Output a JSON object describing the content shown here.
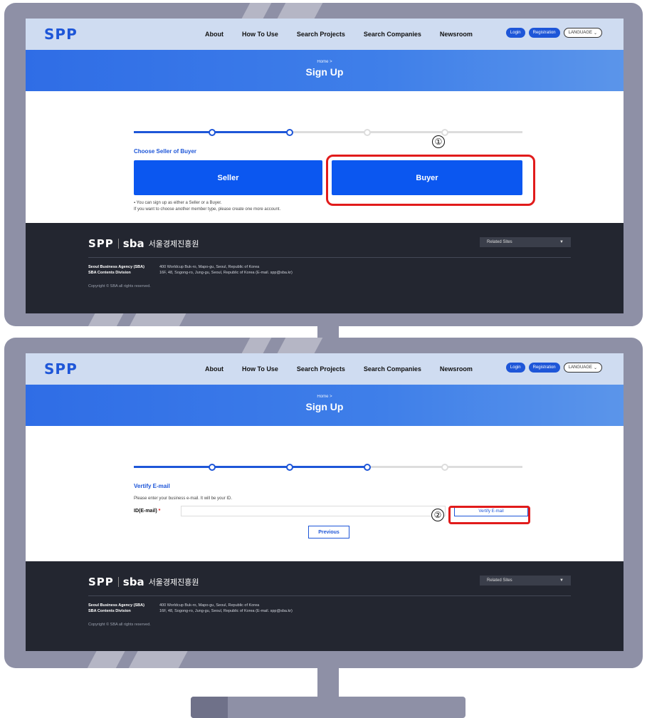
{
  "header": {
    "logo": "SPP",
    "nav": [
      "About",
      "How To Use",
      "Search Projects",
      "Search Companies",
      "Newsroom"
    ],
    "login": "Login",
    "registration": "Registration",
    "language": "LANGUAGE"
  },
  "hero": {
    "breadcrumb": "Home >",
    "title": "Sign Up"
  },
  "screen1": {
    "section_title": "Choose Seller of Buyer",
    "seller_label": "Seller",
    "buyer_label": "Buyer",
    "note_line1": "▪ You can sign up as either a Seller or a Buyer.",
    "note_line2": "If you want to choose another member type, please create one more account.",
    "step_marker": "①"
  },
  "screen2": {
    "section_title": "Vertify E-mail",
    "instruction": "Please enter your business e-mail. It will be your ID.",
    "id_label": "ID(E-mail)",
    "required_mark": "*",
    "verify_button": "Vertify E-mail",
    "previous_button": "Previous",
    "step_marker": "②"
  },
  "footer": {
    "logo_spp": "SPP",
    "logo_sba": "sba",
    "logo_korean": "서울경제진흥원",
    "related_sites": "Related Sites",
    "org1_name": "Seoul Business Agency (SBA)",
    "org1_addr": "400 Worldcup Buk-ro, Mapo-gu, Seoul, Republic of Korea",
    "org2_name": "SBA Contents Division",
    "org2_addr": "16F, 48, Sogong-ro, Jung-gu, Seoul, Republic of Korea (E-mail. spp@sba.kr)",
    "copyright": "Copyright © SBA all rights reserved."
  },
  "colors": {
    "brand_blue": "#1e56d8",
    "button_blue": "#0b57f0",
    "callout_red": "#e11b1b",
    "monitor_gray": "#8e90a6",
    "footer_dark": "#232630"
  }
}
